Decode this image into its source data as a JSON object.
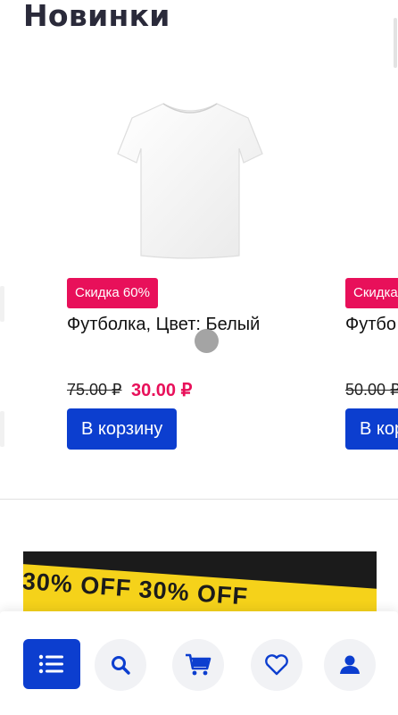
{
  "section": {
    "title": "Новинки"
  },
  "products": [
    {
      "image_alt": "Белая футболка",
      "badge": "Скидка 60%",
      "name": "Футболка, Цвет: Белый",
      "old_price": "75.00 ₽",
      "new_price": "30.00 ₽",
      "cart_label": "В корзину"
    },
    {
      "badge": "Скидка",
      "name": "Футбо",
      "old_price": "50.00 ₽",
      "cart_label": "В кор"
    }
  ],
  "promo": {
    "text": "30% OFF    30% OFF"
  },
  "bottom_nav": {
    "items": [
      {
        "icon": "catalog-list-icon",
        "active": true
      },
      {
        "icon": "search-icon"
      },
      {
        "icon": "cart-icon"
      },
      {
        "icon": "heart-icon"
      },
      {
        "icon": "user-icon"
      }
    ]
  },
  "colors": {
    "accent": "#0c3ecf",
    "sale": "#e8105a",
    "nav_bg": "#f1f2f5"
  }
}
